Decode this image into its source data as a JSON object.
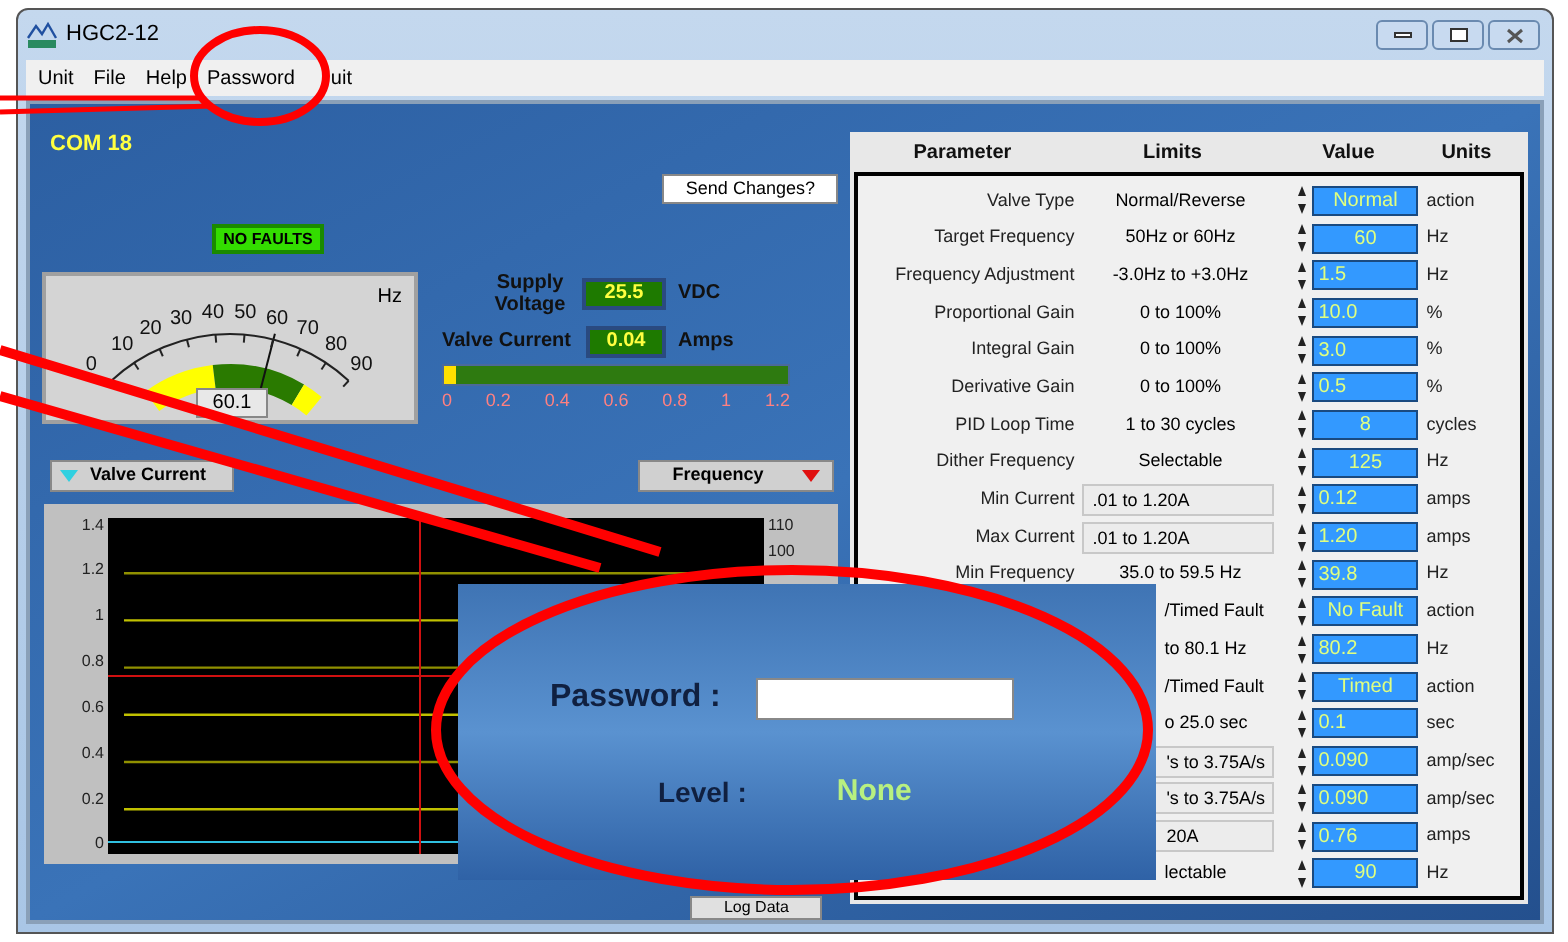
{
  "window": {
    "title": "HGC2-12"
  },
  "menu": [
    "Unit",
    "File",
    "Help",
    "Password",
    "uit"
  ],
  "port": "COM 18",
  "send_button": "Send Changes?",
  "fault_status": "NO FAULTS",
  "gauge": {
    "unit": "Hz",
    "ticks": [
      "0",
      "10",
      "20",
      "30",
      "40",
      "50",
      "60",
      "70",
      "80",
      "90"
    ],
    "reading": "60.1"
  },
  "supply": {
    "label": "Supply Voltage",
    "value": "25.5",
    "unit": "VDC"
  },
  "current": {
    "label": "Valve Current",
    "value": "0.04",
    "unit": "Amps",
    "level": 0.033,
    "ticks": [
      "0",
      "0.2",
      "0.4",
      "0.6",
      "0.8",
      "1",
      "1.2"
    ]
  },
  "left_selector": "Valve Current",
  "right_selector": "Frequency",
  "plot": {
    "left_ticks": [
      "1.4",
      "1.2",
      "1",
      "0.8",
      "0.6",
      "0.4",
      "0.2",
      "0"
    ],
    "right_ticks": [
      "110",
      "100"
    ]
  },
  "log_button": "Log Data",
  "table": {
    "columns": [
      "Parameter",
      "Limits",
      "Value",
      "Units"
    ],
    "rows": [
      {
        "label": "Valve Type",
        "limits": "Normal/Reverse",
        "limits_field": false,
        "value": "Normal",
        "kind": "select",
        "unit": "action"
      },
      {
        "label": "Target Frequency",
        "limits": "50Hz or 60Hz",
        "limits_field": false,
        "value": "60",
        "kind": "select",
        "unit": "Hz"
      },
      {
        "label": "Frequency Adjustment",
        "limits": "-3.0Hz to +3.0Hz",
        "limits_field": false,
        "value": "1.5",
        "kind": "number",
        "unit": "Hz"
      },
      {
        "label": "Proportional Gain",
        "limits": "0 to 100%",
        "limits_field": false,
        "value": "10.0",
        "kind": "number",
        "unit": "%"
      },
      {
        "label": "Integral Gain",
        "limits": "0 to 100%",
        "limits_field": false,
        "value": "3.0",
        "kind": "number",
        "unit": "%"
      },
      {
        "label": "Derivative Gain",
        "limits": "0 to 100%",
        "limits_field": false,
        "value": "0.5",
        "kind": "number",
        "unit": "%"
      },
      {
        "label": "PID Loop Time",
        "limits": "1 to 30 cycles",
        "limits_field": false,
        "value": "8",
        "kind": "select",
        "unit": "cycles"
      },
      {
        "label": "Dither Frequency",
        "limits": "Selectable",
        "limits_field": false,
        "value": "125",
        "kind": "select",
        "unit": "Hz"
      },
      {
        "label": "Min Current",
        "limits": ".01 to 1.20A",
        "limits_field": true,
        "value": "0.12",
        "kind": "number",
        "unit": "amps"
      },
      {
        "label": "Max Current",
        "limits": ".01 to 1.20A",
        "limits_field": true,
        "value": "1.20",
        "kind": "number",
        "unit": "amps"
      },
      {
        "label": "Min Frequency",
        "limits": "35.0 to 59.5 Hz",
        "limits_field": false,
        "value": "39.8",
        "kind": "number",
        "unit": "Hz"
      },
      {
        "limits": "/Timed Fault",
        "limits_field": false,
        "value": "No Fault",
        "kind": "select",
        "unit": "action"
      },
      {
        "limits": "to 80.1 Hz",
        "limits_field": false,
        "value": "80.2",
        "kind": "number",
        "unit": "Hz"
      },
      {
        "limits": "/Timed Fault",
        "limits_field": false,
        "value": "Timed",
        "kind": "select",
        "unit": "action"
      },
      {
        "limits": "o 25.0 sec",
        "limits_field": false,
        "value": "0.1",
        "kind": "number",
        "unit": "sec"
      },
      {
        "limits": "'s to 3.75A/s",
        "limits_field": true,
        "value": "0.090",
        "kind": "number",
        "unit": "amp/sec"
      },
      {
        "limits": "'s to 3.75A/s",
        "limits_field": true,
        "value": "0.090",
        "kind": "number",
        "unit": "amp/sec"
      },
      {
        "limits": "20A",
        "limits_field": true,
        "value": "0.76",
        "kind": "number",
        "unit": "amps"
      },
      {
        "limits": "lectable",
        "limits_field": false,
        "value": "90",
        "kind": "select",
        "unit": "Hz"
      }
    ]
  },
  "dialog": {
    "password_label": "Password :",
    "level_label": "Level :",
    "level_value": "None"
  }
}
